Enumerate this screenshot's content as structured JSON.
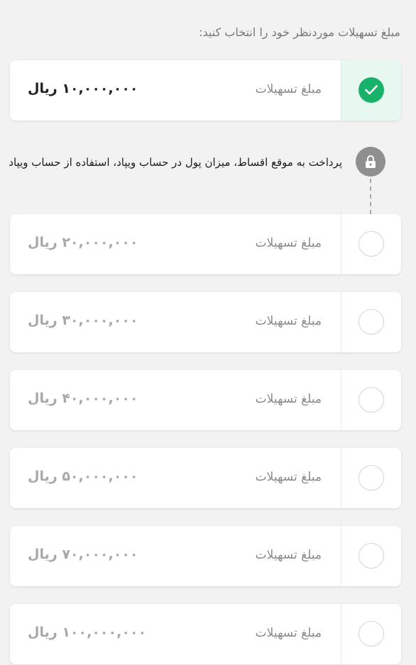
{
  "header": {
    "title": "مبلغ تسهیلات موردنظر خود را انتخاب کنید:"
  },
  "notice": {
    "text": "پرداخت به موقع اقساط، میزان پول در حساب ویپاد، استفاده از حساب ویپاد",
    "icon": "lock-icon"
  },
  "colors": {
    "accent": "#18b26b",
    "selected_bg": "#e6f8ef",
    "lock_badge": "#8f8f8f"
  },
  "options": [
    {
      "label": "مبلغ تسهیلات",
      "amount": "۱۰,۰۰۰,۰۰۰ ریال",
      "selected": true,
      "locked": false
    },
    {
      "label": "مبلغ تسهیلات",
      "amount": "۲۰,۰۰۰,۰۰۰ ریال",
      "selected": false,
      "locked": true
    },
    {
      "label": "مبلغ تسهیلات",
      "amount": "۳۰,۰۰۰,۰۰۰ ریال",
      "selected": false,
      "locked": true
    },
    {
      "label": "مبلغ تسهیلات",
      "amount": "۴۰,۰۰۰,۰۰۰ ریال",
      "selected": false,
      "locked": true
    },
    {
      "label": "مبلغ تسهیلات",
      "amount": "۵۰,۰۰۰,۰۰۰ ریال",
      "selected": false,
      "locked": true
    },
    {
      "label": "مبلغ تسهیلات",
      "amount": "۷۰,۰۰۰,۰۰۰ ریال",
      "selected": false,
      "locked": true
    },
    {
      "label": "مبلغ تسهیلات",
      "amount": "۱۰۰,۰۰۰,۰۰۰ ریال",
      "selected": false,
      "locked": true
    }
  ]
}
